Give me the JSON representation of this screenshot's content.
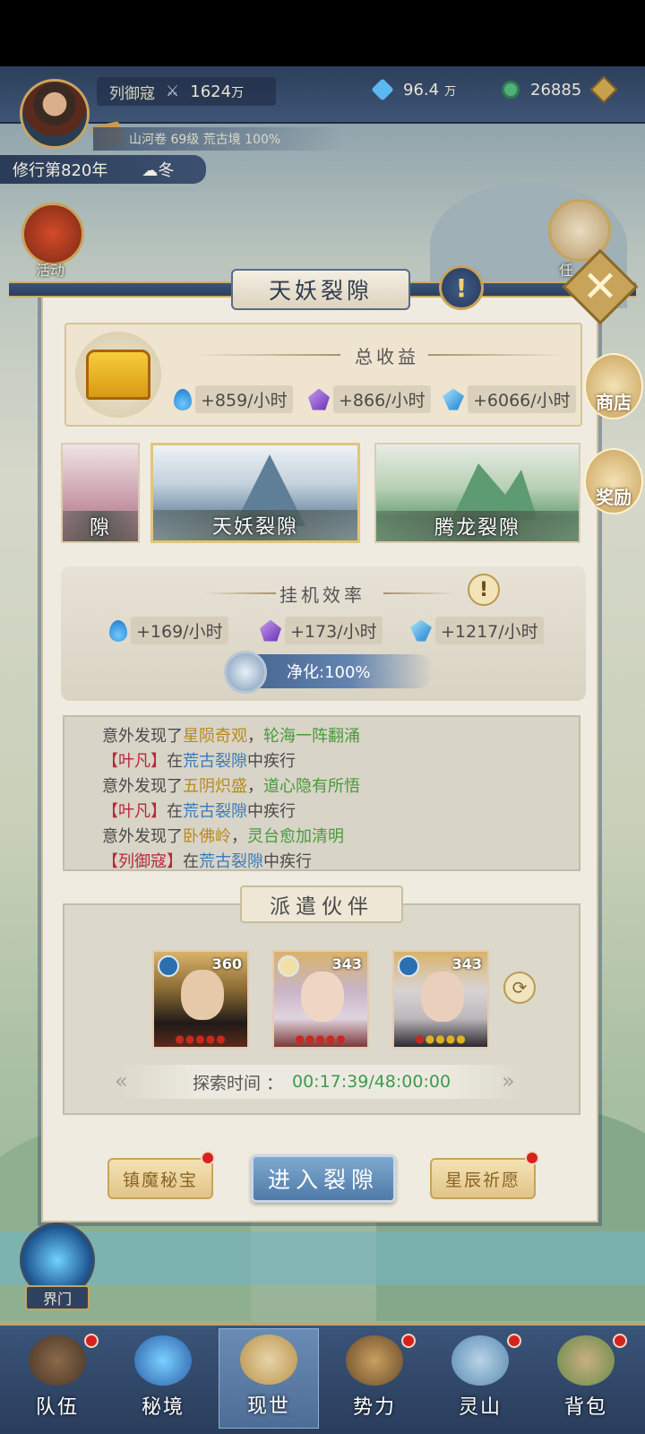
{
  "header": {
    "player_name": "列御寇",
    "power": "1624",
    "power_unit": "万",
    "currency1": "96.4",
    "currency1_unit": "万",
    "currency2": "26885",
    "book_line": "山河卷 69级 荒古境 100%",
    "year": "修行第820年",
    "season": "冬"
  },
  "side": {
    "activity": "活动",
    "task": "任",
    "shop": "商店",
    "reward": "奖励"
  },
  "panel": {
    "title": "天妖裂隙",
    "total_income_title": "总收益",
    "income": [
      {
        "icon": "blue-flame-icon",
        "text": "+859/小时"
      },
      {
        "icon": "purple-crystal-icon",
        "text": "+866/小时"
      },
      {
        "icon": "blue-crystal-icon",
        "text": "+6066/小时"
      }
    ],
    "rifts": [
      {
        "label": "隙"
      },
      {
        "label": "天妖裂隙"
      },
      {
        "label": "腾龙裂隙"
      }
    ],
    "efficiency_title": "挂机效率",
    "efficiency": [
      {
        "icon": "blue-flame-icon",
        "text": "+169/小时"
      },
      {
        "icon": "purple-crystal-icon",
        "text": "+173/小时"
      },
      {
        "icon": "blue-crystal-icon",
        "text": "+1217/小时"
      }
    ],
    "purify": "净化:100%",
    "log": [
      [
        {
          "t": "意外发现了",
          "c": "plain"
        },
        {
          "t": "星陨奇观",
          "c": "gold"
        },
        {
          "t": "，",
          "c": "plain"
        },
        {
          "t": "轮海一阵翻涌",
          "c": "green"
        }
      ],
      [
        {
          "t": "【叶凡】",
          "c": "red"
        },
        {
          "t": "在",
          "c": "plain"
        },
        {
          "t": "荒古裂隙",
          "c": "blue"
        },
        {
          "t": "中疾行",
          "c": "plain"
        }
      ],
      [
        {
          "t": "意外发现了",
          "c": "plain"
        },
        {
          "t": "五阴炽盛",
          "c": "gold"
        },
        {
          "t": "，",
          "c": "plain"
        },
        {
          "t": "道心隐有所悟",
          "c": "green"
        }
      ],
      [
        {
          "t": "【叶凡】",
          "c": "red"
        },
        {
          "t": "在",
          "c": "plain"
        },
        {
          "t": "荒古裂隙",
          "c": "blue"
        },
        {
          "t": "中疾行",
          "c": "plain"
        }
      ],
      [
        {
          "t": "意外发现了",
          "c": "plain"
        },
        {
          "t": "卧佛岭",
          "c": "gold"
        },
        {
          "t": "，",
          "c": "plain"
        },
        {
          "t": "灵台愈加清明",
          "c": "green"
        }
      ],
      [
        {
          "t": "【列御寇】",
          "c": "red"
        },
        {
          "t": "在",
          "c": "plain"
        },
        {
          "t": "荒古裂隙",
          "c": "blue"
        },
        {
          "t": "中疾行",
          "c": "plain"
        }
      ]
    ],
    "dispatch_title": "派遣伙伴",
    "partners": [
      {
        "level": "360"
      },
      {
        "level": "343"
      },
      {
        "level": "343"
      }
    ],
    "explore_label": "探索时间 ：",
    "explore_time": "00:17:39/48:00:00",
    "buttons": {
      "left": "镇魔秘宝",
      "main": "进入裂隙",
      "right": "星辰祈愿"
    }
  },
  "gate_label": "界门",
  "nav": [
    {
      "label": "队伍",
      "dot": true
    },
    {
      "label": "秘境",
      "dot": false
    },
    {
      "label": "现世",
      "dot": false
    },
    {
      "label": "势力",
      "dot": true
    },
    {
      "label": "灵山",
      "dot": true
    },
    {
      "label": "背包",
      "dot": true
    }
  ]
}
